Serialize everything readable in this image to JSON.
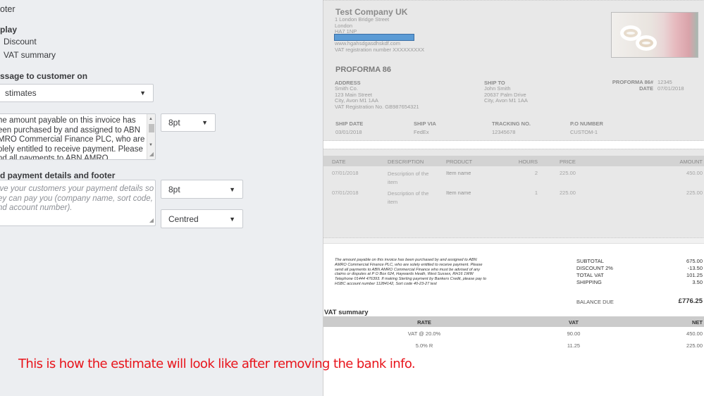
{
  "settings": {
    "section_title": "oter",
    "display_heading": "play",
    "display_options": [
      "Discount",
      "VAT summary"
    ],
    "message_heading": "ssage to customer on",
    "message_select": "stimates",
    "message_text_lines": [
      "he amount payable on this invoice has",
      "een purchased by and assigned to ABN",
      "MRO Commercial Finance PLC, who are",
      "olely entitled to receive payment. Please",
      "nd all payments to ABN AMRO"
    ],
    "message_font_size": "8pt",
    "footer_heading": "d payment details and footer",
    "footer_placeholder_lines": [
      "ive your customers your payment details so",
      "ey can pay you (company name, sort code,",
      "nd account number)."
    ],
    "footer_font_size": "8pt",
    "footer_alignment": "Centred"
  },
  "preview": {
    "company": {
      "name": "Test Company UK",
      "address": [
        "1 London Bridge Street",
        "London",
        "HA7 1NP"
      ],
      "website": "www.hgahsdgasdhskdf.com",
      "vat": "VAT registration number XXXXXXXXX",
      "highlight_color": "#5b9bd5"
    },
    "doc_title": "PROFORMA 86",
    "address": {
      "label": "ADDRESS",
      "lines": [
        "Smith Co.",
        "123 Main Street",
        "City, Avon M1 1AA",
        "VAT Registration No. GB987654321"
      ]
    },
    "ship_to": {
      "label": "SHIP TO",
      "lines": [
        "John Smith",
        "20637 Palm Drive",
        "City, Avon M1 1AA"
      ]
    },
    "meta": [
      {
        "label": "PROFORMA 86#",
        "value": "12345"
      },
      {
        "label": "DATE",
        "value": "07/01/2018"
      }
    ],
    "shipping": [
      {
        "label": "SHIP DATE",
        "value": "03/01/2018"
      },
      {
        "label": "SHIP VIA",
        "value": "FedEx"
      },
      {
        "label": "TRACKING NO.",
        "value": "12345678"
      },
      {
        "label": "P.O NUMBER",
        "value": "CUSTOM-1"
      }
    ],
    "items": {
      "headers": [
        "DATE",
        "DESCRIPTION",
        "PRODUCT",
        "HOURS",
        "PRICE",
        "AMOUNT"
      ],
      "rows": [
        {
          "date": "07/01/2018",
          "desc1": "Description of the",
          "desc2": "item",
          "product": "Item name",
          "hours": "2",
          "price": "225.00",
          "amount": "450.00"
        },
        {
          "date": "07/01/2018",
          "desc1": "Description of the",
          "desc2": "item",
          "product": "Item name",
          "hours": "1",
          "price": "225.00",
          "amount": "225.00"
        }
      ]
    },
    "footer_message": "The amount payable on this invoice has been purchased by and assigned to ABN AMRO Commercial Finance PLC, who are solely entitled to receive payment. Please send all payments to ABN AMRO Commercial Finance who must be advised of any claims or disputes at P O Box 624, Haywards Heath, West Sussex, RH16 1WW Telephone 01444 476393. If making Sterling payment by Bankers Credit, please pay to HSBC account number 11284142, Sort code 40-23-27 test",
    "totals": [
      {
        "label": "SUBTOTAL",
        "value": "675.00"
      },
      {
        "label": "DISCOUNT 2%",
        "value": "-13.50"
      },
      {
        "label": "TOTAL VAT",
        "value": "101.25"
      },
      {
        "label": "SHIPPING",
        "value": "3.50"
      }
    ],
    "balance": {
      "label": "BALANCE DUE",
      "value": "£776.25"
    },
    "vat_summary": {
      "title": "VAT summary",
      "headers": [
        "RATE",
        "VAT",
        "NET"
      ],
      "rows": [
        [
          "VAT @ 20.0%",
          "90.00",
          "450.00"
        ],
        [
          "5.0% R",
          "11.25",
          "225.00"
        ]
      ]
    }
  },
  "annotation": "This is how the estimate will look like after removing the bank info."
}
